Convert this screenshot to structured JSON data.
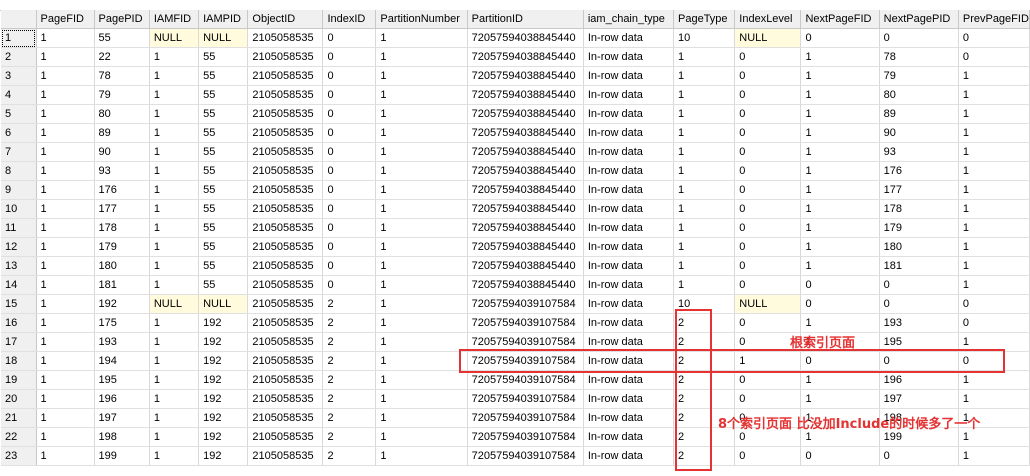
{
  "columns": [
    "",
    "PageFID",
    "PagePID",
    "IAMFID",
    "IAMPID",
    "ObjectID",
    "IndexID",
    "PartitionNumber",
    "PartitionID",
    "iam_chain_type",
    "PageType",
    "IndexLevel",
    "NextPageFID",
    "NextPagePID",
    "PrevPageFID"
  ],
  "rows": [
    [
      "1",
      "1",
      "55",
      "NULL",
      "NULL",
      "2105058535",
      "0",
      "1",
      "72057594038845440",
      "In-row data",
      "10",
      "NULL",
      "0",
      "0",
      "0"
    ],
    [
      "2",
      "1",
      "22",
      "1",
      "55",
      "2105058535",
      "0",
      "1",
      "72057594038845440",
      "In-row data",
      "1",
      "0",
      "1",
      "78",
      "0"
    ],
    [
      "3",
      "1",
      "78",
      "1",
      "55",
      "2105058535",
      "0",
      "1",
      "72057594038845440",
      "In-row data",
      "1",
      "0",
      "1",
      "79",
      "1"
    ],
    [
      "4",
      "1",
      "79",
      "1",
      "55",
      "2105058535",
      "0",
      "1",
      "72057594038845440",
      "In-row data",
      "1",
      "0",
      "1",
      "80",
      "1"
    ],
    [
      "5",
      "1",
      "80",
      "1",
      "55",
      "2105058535",
      "0",
      "1",
      "72057594038845440",
      "In-row data",
      "1",
      "0",
      "1",
      "89",
      "1"
    ],
    [
      "6",
      "1",
      "89",
      "1",
      "55",
      "2105058535",
      "0",
      "1",
      "72057594038845440",
      "In-row data",
      "1",
      "0",
      "1",
      "90",
      "1"
    ],
    [
      "7",
      "1",
      "90",
      "1",
      "55",
      "2105058535",
      "0",
      "1",
      "72057594038845440",
      "In-row data",
      "1",
      "0",
      "1",
      "93",
      "1"
    ],
    [
      "8",
      "1",
      "93",
      "1",
      "55",
      "2105058535",
      "0",
      "1",
      "72057594038845440",
      "In-row data",
      "1",
      "0",
      "1",
      "176",
      "1"
    ],
    [
      "9",
      "1",
      "176",
      "1",
      "55",
      "2105058535",
      "0",
      "1",
      "72057594038845440",
      "In-row data",
      "1",
      "0",
      "1",
      "177",
      "1"
    ],
    [
      "10",
      "1",
      "177",
      "1",
      "55",
      "2105058535",
      "0",
      "1",
      "72057594038845440",
      "In-row data",
      "1",
      "0",
      "1",
      "178",
      "1"
    ],
    [
      "11",
      "1",
      "178",
      "1",
      "55",
      "2105058535",
      "0",
      "1",
      "72057594038845440",
      "In-row data",
      "1",
      "0",
      "1",
      "179",
      "1"
    ],
    [
      "12",
      "1",
      "179",
      "1",
      "55",
      "2105058535",
      "0",
      "1",
      "72057594038845440",
      "In-row data",
      "1",
      "0",
      "1",
      "180",
      "1"
    ],
    [
      "13",
      "1",
      "180",
      "1",
      "55",
      "2105058535",
      "0",
      "1",
      "72057594038845440",
      "In-row data",
      "1",
      "0",
      "1",
      "181",
      "1"
    ],
    [
      "14",
      "1",
      "181",
      "1",
      "55",
      "2105058535",
      "0",
      "1",
      "72057594038845440",
      "In-row data",
      "1",
      "0",
      "0",
      "0",
      "1"
    ],
    [
      "15",
      "1",
      "192",
      "NULL",
      "NULL",
      "2105058535",
      "2",
      "1",
      "72057594039107584",
      "In-row data",
      "10",
      "NULL",
      "0",
      "0",
      "0"
    ],
    [
      "16",
      "1",
      "175",
      "1",
      "192",
      "2105058535",
      "2",
      "1",
      "72057594039107584",
      "In-row data",
      "2",
      "0",
      "1",
      "193",
      "0"
    ],
    [
      "17",
      "1",
      "193",
      "1",
      "192",
      "2105058535",
      "2",
      "1",
      "72057594039107584",
      "In-row data",
      "2",
      "0",
      "1",
      "195",
      "1"
    ],
    [
      "18",
      "1",
      "194",
      "1",
      "192",
      "2105058535",
      "2",
      "1",
      "72057594039107584",
      "In-row data",
      "2",
      "1",
      "0",
      "0",
      "0"
    ],
    [
      "19",
      "1",
      "195",
      "1",
      "192",
      "2105058535",
      "2",
      "1",
      "72057594039107584",
      "In-row data",
      "2",
      "0",
      "1",
      "196",
      "1"
    ],
    [
      "20",
      "1",
      "196",
      "1",
      "192",
      "2105058535",
      "2",
      "1",
      "72057594039107584",
      "In-row data",
      "2",
      "0",
      "1",
      "197",
      "1"
    ],
    [
      "21",
      "1",
      "197",
      "1",
      "192",
      "2105058535",
      "2",
      "1",
      "72057594039107584",
      "In-row data",
      "2",
      "0",
      "1",
      "198",
      "1"
    ],
    [
      "22",
      "1",
      "198",
      "1",
      "192",
      "2105058535",
      "2",
      "1",
      "72057594039107584",
      "In-row data",
      "2",
      "0",
      "1",
      "199",
      "1"
    ],
    [
      "23",
      "1",
      "199",
      "1",
      "192",
      "2105058535",
      "2",
      "1",
      "72057594039107584",
      "In-row data",
      "2",
      "0",
      "0",
      "0",
      "1"
    ]
  ],
  "annotations": {
    "root_label": "根索引页面",
    "pages_label": "8个索引页面 比没加Include的时候多了一个"
  },
  "colors": {
    "null_background": "#fffbdc",
    "annotation_red": "#e53333",
    "header_gray": "#f0f0f0"
  }
}
